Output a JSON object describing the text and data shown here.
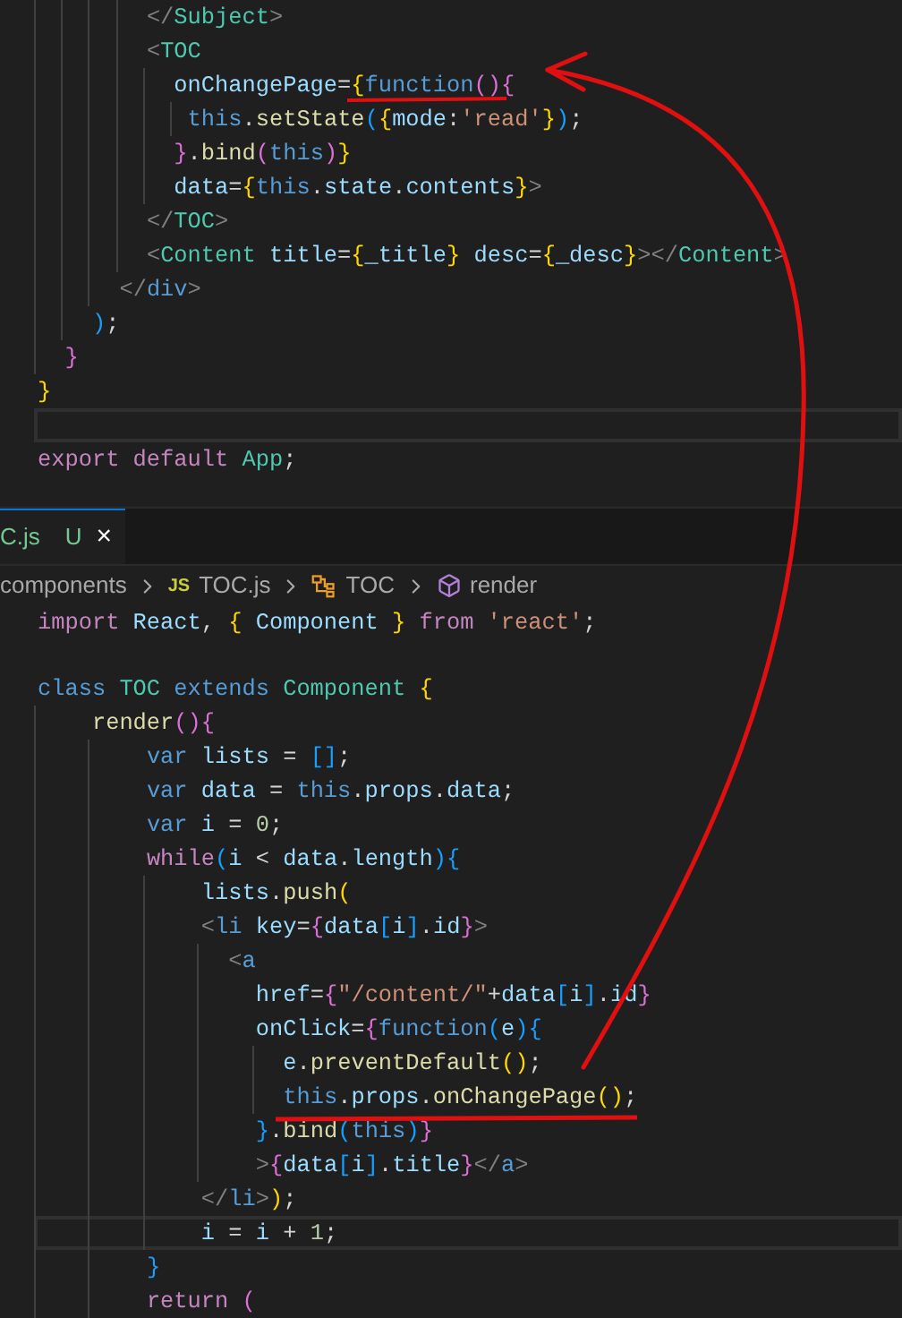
{
  "editor_top": {
    "lines": [
      {
        "current": false,
        "tokens": [
          {
            "kind": "tag",
            "text": "        </"
          },
          {
            "kind": "comp",
            "text": "Subject"
          },
          {
            "kind": "tag",
            "text": ">"
          }
        ]
      },
      {
        "current": false,
        "tokens": [
          {
            "kind": "tag",
            "text": "        <"
          },
          {
            "kind": "comp",
            "text": "TOC"
          }
        ]
      },
      {
        "current": false,
        "tokens": [
          {
            "kind": "attr",
            "text": "          onChangePage"
          },
          {
            "kind": "p",
            "text": "="
          },
          {
            "kind": "b1",
            "text": "{"
          },
          {
            "kind": "kw",
            "text": "function"
          },
          {
            "kind": "b2",
            "text": "(){"
          }
        ]
      },
      {
        "current": false,
        "tokens": [
          {
            "kind": "kw",
            "text": "           this"
          },
          {
            "kind": "p",
            "text": "."
          },
          {
            "kind": "fn",
            "text": "setState"
          },
          {
            "kind": "b3",
            "text": "("
          },
          {
            "kind": "b1",
            "text": "{"
          },
          {
            "kind": "var",
            "text": "mode"
          },
          {
            "kind": "p",
            "text": ":"
          },
          {
            "kind": "str",
            "text": "'read'"
          },
          {
            "kind": "b1",
            "text": "}"
          },
          {
            "kind": "b3",
            "text": ")"
          },
          {
            "kind": "p",
            "text": ";"
          }
        ]
      },
      {
        "current": false,
        "tokens": [
          {
            "kind": "b2",
            "text": "          }"
          },
          {
            "kind": "p",
            "text": "."
          },
          {
            "kind": "fn",
            "text": "bind"
          },
          {
            "kind": "b2",
            "text": "("
          },
          {
            "kind": "kw",
            "text": "this"
          },
          {
            "kind": "b2",
            "text": ")"
          },
          {
            "kind": "b1",
            "text": "}"
          }
        ]
      },
      {
        "current": false,
        "tokens": [
          {
            "kind": "attr",
            "text": "          data"
          },
          {
            "kind": "p",
            "text": "="
          },
          {
            "kind": "b1",
            "text": "{"
          },
          {
            "kind": "kw",
            "text": "this"
          },
          {
            "kind": "p",
            "text": "."
          },
          {
            "kind": "var",
            "text": "state"
          },
          {
            "kind": "p",
            "text": "."
          },
          {
            "kind": "var",
            "text": "contents"
          },
          {
            "kind": "b1",
            "text": "}"
          },
          {
            "kind": "tag",
            "text": ">"
          }
        ]
      },
      {
        "current": false,
        "tokens": [
          {
            "kind": "tag",
            "text": "        </"
          },
          {
            "kind": "comp",
            "text": "TOC"
          },
          {
            "kind": "tag",
            "text": ">"
          }
        ]
      },
      {
        "current": false,
        "tokens": [
          {
            "kind": "tag",
            "text": "        <"
          },
          {
            "kind": "comp",
            "text": "Content"
          },
          {
            "kind": "attr",
            "text": " title"
          },
          {
            "kind": "p",
            "text": "="
          },
          {
            "kind": "b1",
            "text": "{"
          },
          {
            "kind": "var",
            "text": "_title"
          },
          {
            "kind": "b1",
            "text": "}"
          },
          {
            "kind": "attr",
            "text": " desc"
          },
          {
            "kind": "p",
            "text": "="
          },
          {
            "kind": "b1",
            "text": "{"
          },
          {
            "kind": "var",
            "text": "_desc"
          },
          {
            "kind": "b1",
            "text": "}"
          },
          {
            "kind": "tag",
            "text": "></"
          },
          {
            "kind": "comp",
            "text": "Content"
          },
          {
            "kind": "tag",
            "text": ">"
          }
        ]
      },
      {
        "current": false,
        "tokens": [
          {
            "kind": "tag",
            "text": "      </"
          },
          {
            "kind": "kw",
            "text": "div"
          },
          {
            "kind": "tag",
            "text": ">"
          }
        ]
      },
      {
        "current": false,
        "tokens": [
          {
            "kind": "b3",
            "text": "    )"
          },
          {
            "kind": "p",
            "text": ";"
          }
        ]
      },
      {
        "current": false,
        "tokens": [
          {
            "kind": "b2",
            "text": "  }"
          }
        ]
      },
      {
        "current": false,
        "tokens": [
          {
            "kind": "b1",
            "text": "}"
          }
        ]
      },
      {
        "current": true
      },
      {
        "current": false,
        "tokens": [
          {
            "kind": "ctl",
            "text": "export"
          },
          {
            "kind": "ctl",
            "text": " default"
          },
          {
            "kind": "comp",
            "text": " App"
          },
          {
            "kind": "p",
            "text": ";"
          }
        ]
      }
    ]
  },
  "tab": {
    "label": "C.js",
    "badge": "U",
    "close": "×"
  },
  "breadcrumb": [
    {
      "kind": "folder",
      "label": "components"
    },
    {
      "kind": "file",
      "icon": "JS",
      "label": "TOC.js"
    },
    {
      "kind": "class",
      "label": "TOC"
    },
    {
      "kind": "method",
      "label": "render"
    }
  ],
  "editor_bottom": {
    "lines": [
      {
        "current": false,
        "tokens": [
          {
            "kind": "ctl",
            "text": "import"
          },
          {
            "kind": "var",
            "text": " React"
          },
          {
            "kind": "p",
            "text": ","
          },
          {
            "kind": "b1",
            "text": " {"
          },
          {
            "kind": "var",
            "text": " Component"
          },
          {
            "kind": "b1",
            "text": " }"
          },
          {
            "kind": "ctl",
            "text": " from"
          },
          {
            "kind": "str",
            "text": " 'react'"
          },
          {
            "kind": "p",
            "text": ";"
          }
        ]
      },
      {
        "current": false
      },
      {
        "current": false,
        "tokens": [
          {
            "kind": "kw",
            "text": "class"
          },
          {
            "kind": "comp",
            "text": " TOC"
          },
          {
            "kind": "kw",
            "text": " extends"
          },
          {
            "kind": "comp",
            "text": " Component"
          },
          {
            "kind": "b1",
            "text": " {"
          }
        ]
      },
      {
        "current": false,
        "tokens": [
          {
            "kind": "fn",
            "text": "    render"
          },
          {
            "kind": "b2",
            "text": "(){"
          }
        ]
      },
      {
        "current": false,
        "tokens": [
          {
            "kind": "kw",
            "text": "        var"
          },
          {
            "kind": "var",
            "text": " lists"
          },
          {
            "kind": "p",
            "text": " ="
          },
          {
            "kind": "b3",
            "text": " []"
          },
          {
            "kind": "p",
            "text": ";"
          }
        ]
      },
      {
        "current": false,
        "tokens": [
          {
            "kind": "kw",
            "text": "        var"
          },
          {
            "kind": "var",
            "text": " data"
          },
          {
            "kind": "p",
            "text": " ="
          },
          {
            "kind": "kw",
            "text": " this"
          },
          {
            "kind": "p",
            "text": "."
          },
          {
            "kind": "var",
            "text": "props"
          },
          {
            "kind": "p",
            "text": "."
          },
          {
            "kind": "var",
            "text": "data"
          },
          {
            "kind": "p",
            "text": ";"
          }
        ]
      },
      {
        "current": false,
        "tokens": [
          {
            "kind": "kw",
            "text": "        var"
          },
          {
            "kind": "var",
            "text": " i"
          },
          {
            "kind": "p",
            "text": " ="
          },
          {
            "kind": "num",
            "text": " 0"
          },
          {
            "kind": "p",
            "text": ";"
          }
        ]
      },
      {
        "current": false,
        "tokens": [
          {
            "kind": "ctl",
            "text": "        while"
          },
          {
            "kind": "b3",
            "text": "("
          },
          {
            "kind": "var",
            "text": "i"
          },
          {
            "kind": "p",
            "text": " <"
          },
          {
            "kind": "var",
            "text": " data"
          },
          {
            "kind": "p",
            "text": "."
          },
          {
            "kind": "var",
            "text": "length"
          },
          {
            "kind": "b3",
            "text": "){"
          }
        ]
      },
      {
        "current": false,
        "tokens": [
          {
            "kind": "var",
            "text": "            lists"
          },
          {
            "kind": "p",
            "text": "."
          },
          {
            "kind": "fn",
            "text": "push"
          },
          {
            "kind": "b1",
            "text": "("
          }
        ]
      },
      {
        "current": false,
        "tokens": [
          {
            "kind": "tag",
            "text": "            <"
          },
          {
            "kind": "kw",
            "text": "li"
          },
          {
            "kind": "attr",
            "text": " key"
          },
          {
            "kind": "p",
            "text": "="
          },
          {
            "kind": "b2",
            "text": "{"
          },
          {
            "kind": "var",
            "text": "data"
          },
          {
            "kind": "b3",
            "text": "["
          },
          {
            "kind": "var",
            "text": "i"
          },
          {
            "kind": "b3",
            "text": "]"
          },
          {
            "kind": "p",
            "text": "."
          },
          {
            "kind": "var",
            "text": "id"
          },
          {
            "kind": "b2",
            "text": "}"
          },
          {
            "kind": "tag",
            "text": ">"
          }
        ]
      },
      {
        "current": false,
        "tokens": [
          {
            "kind": "tag",
            "text": "              <"
          },
          {
            "kind": "kw",
            "text": "a"
          }
        ]
      },
      {
        "current": false,
        "tokens": [
          {
            "kind": "attr",
            "text": "                href"
          },
          {
            "kind": "p",
            "text": "="
          },
          {
            "kind": "b2",
            "text": "{"
          },
          {
            "kind": "str",
            "text": "\"/content/\""
          },
          {
            "kind": "p",
            "text": "+"
          },
          {
            "kind": "var",
            "text": "data"
          },
          {
            "kind": "b3",
            "text": "["
          },
          {
            "kind": "var",
            "text": "i"
          },
          {
            "kind": "b3",
            "text": "]"
          },
          {
            "kind": "p",
            "text": "."
          },
          {
            "kind": "var",
            "text": "id"
          },
          {
            "kind": "b2",
            "text": "}"
          }
        ]
      },
      {
        "current": false,
        "tokens": [
          {
            "kind": "attr",
            "text": "                onClick"
          },
          {
            "kind": "p",
            "text": "="
          },
          {
            "kind": "b2",
            "text": "{"
          },
          {
            "kind": "kw",
            "text": "function"
          },
          {
            "kind": "b3",
            "text": "("
          },
          {
            "kind": "var",
            "text": "e"
          },
          {
            "kind": "b3",
            "text": "){"
          }
        ]
      },
      {
        "current": false,
        "tokens": [
          {
            "kind": "var",
            "text": "                  e"
          },
          {
            "kind": "p",
            "text": "."
          },
          {
            "kind": "fn",
            "text": "preventDefault"
          },
          {
            "kind": "b1",
            "text": "()"
          },
          {
            "kind": "p",
            "text": ";"
          }
        ]
      },
      {
        "current": false,
        "tokens": [
          {
            "kind": "kw",
            "text": "                  this"
          },
          {
            "kind": "p",
            "text": "."
          },
          {
            "kind": "var",
            "text": "props"
          },
          {
            "kind": "p",
            "text": "."
          },
          {
            "kind": "fn",
            "text": "onChangePage"
          },
          {
            "kind": "b1",
            "text": "()"
          },
          {
            "kind": "p",
            "text": ";"
          }
        ]
      },
      {
        "current": false,
        "tokens": [
          {
            "kind": "b3",
            "text": "                }"
          },
          {
            "kind": "p",
            "text": "."
          },
          {
            "kind": "fn",
            "text": "bind"
          },
          {
            "kind": "b3",
            "text": "("
          },
          {
            "kind": "kw",
            "text": "this"
          },
          {
            "kind": "b3",
            "text": ")"
          },
          {
            "kind": "b2",
            "text": "}"
          }
        ]
      },
      {
        "current": false,
        "tokens": [
          {
            "kind": "tag",
            "text": "                >"
          },
          {
            "kind": "b2",
            "text": "{"
          },
          {
            "kind": "var",
            "text": "data"
          },
          {
            "kind": "b3",
            "text": "["
          },
          {
            "kind": "var",
            "text": "i"
          },
          {
            "kind": "b3",
            "text": "]"
          },
          {
            "kind": "p",
            "text": "."
          },
          {
            "kind": "var",
            "text": "title"
          },
          {
            "kind": "b2",
            "text": "}"
          },
          {
            "kind": "tag",
            "text": "</"
          },
          {
            "kind": "kw",
            "text": "a"
          },
          {
            "kind": "tag",
            "text": ">"
          }
        ]
      },
      {
        "current": false,
        "tokens": [
          {
            "kind": "tag",
            "text": "            </"
          },
          {
            "kind": "kw",
            "text": "li"
          },
          {
            "kind": "tag",
            "text": ">"
          },
          {
            "kind": "b1",
            "text": ")"
          },
          {
            "kind": "p",
            "text": ";"
          }
        ]
      },
      {
        "current": true,
        "tokens": [
          {
            "kind": "var",
            "text": "            i"
          },
          {
            "kind": "p",
            "text": " ="
          },
          {
            "kind": "var",
            "text": " i"
          },
          {
            "kind": "p",
            "text": " +"
          },
          {
            "kind": "num",
            "text": " 1"
          },
          {
            "kind": "p",
            "text": ";"
          }
        ]
      },
      {
        "current": false,
        "tokens": [
          {
            "kind": "b3",
            "text": "        }"
          }
        ]
      },
      {
        "current": false,
        "tokens": [
          {
            "kind": "ctl",
            "text": "        return"
          },
          {
            "kind": "b2",
            "text": " ("
          }
        ]
      }
    ]
  }
}
